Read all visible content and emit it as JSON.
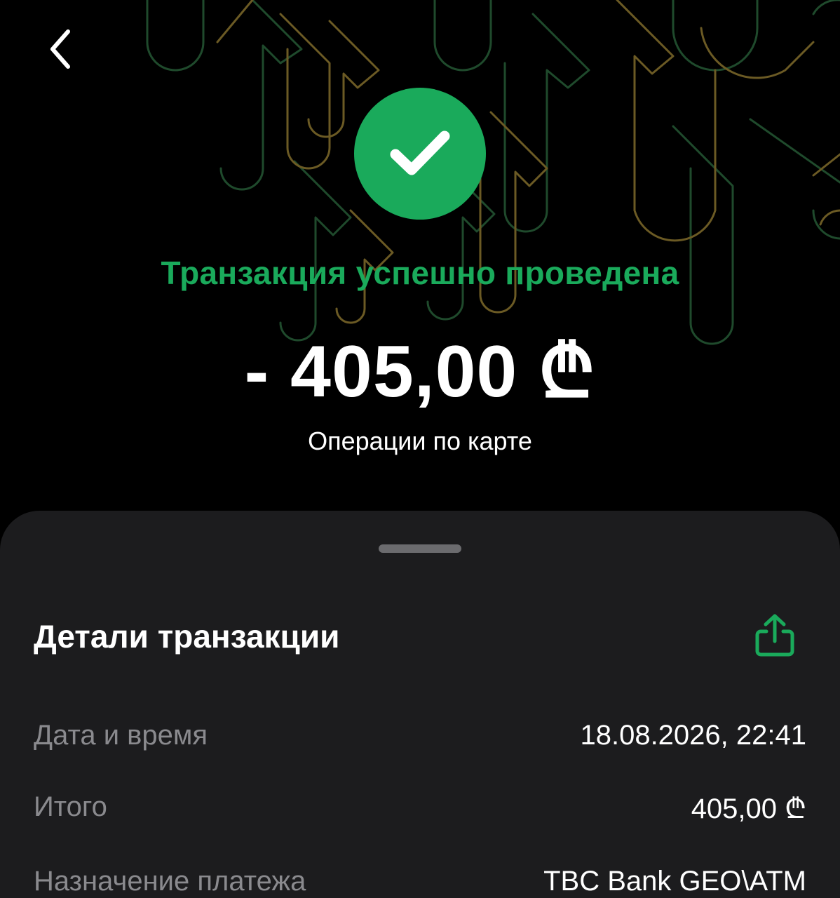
{
  "header": {
    "back_icon": "chevron-left-icon",
    "status_icon": "checkmark-icon",
    "status_title": "Транзакция успешно проведена",
    "amount": "- 405,00 ₾",
    "subtitle": "Операции по карте"
  },
  "details": {
    "title": "Детали транзакции",
    "share_icon": "share-icon",
    "rows": [
      {
        "label": "Дата и время",
        "value": "18.08.2026, 22:41"
      },
      {
        "label": "Итого",
        "value": "405,00 ₾"
      },
      {
        "label": "Назначение платежа",
        "value": "TBC Bank GEO\\ATM"
      }
    ]
  },
  "colors": {
    "accent_green": "#1aaa5b",
    "background": "#000000",
    "sheet_background": "#1c1c1e",
    "muted_text": "#8a8a8e",
    "pattern_gold": "#6b5a24",
    "pattern_green": "#1f4a2c"
  }
}
